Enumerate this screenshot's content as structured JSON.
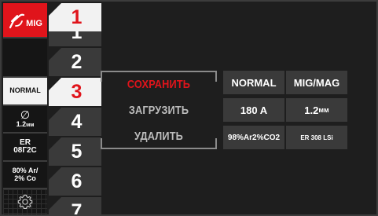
{
  "sidebar": {
    "process": "MIG",
    "mode": "NORMAL",
    "wire_diameter_symbol": "∅",
    "wire_diameter": "1.2",
    "wire_diameter_unit": "мм",
    "wire_type_line1": "ER",
    "wire_type_line2": "08Г2С",
    "gas_line1": "80% Ar/",
    "gas_line2": "2% Co"
  },
  "slots": [
    {
      "label": "1",
      "active": false
    },
    {
      "label": "2",
      "active": false
    },
    {
      "label": "3",
      "active": true
    },
    {
      "label": "4",
      "active": false
    },
    {
      "label": "5",
      "active": false
    },
    {
      "label": "6",
      "active": false
    },
    {
      "label": "7",
      "active": false
    }
  ],
  "menu": {
    "save": "СОХРАНИТЬ",
    "load": "ЗАГРУЗИТЬ",
    "delete": "УДАЛИТЬ"
  },
  "info": {
    "mode": "NORMAL",
    "process": "MIG/MAG",
    "current": "180 A",
    "wire_value": "1.2",
    "wire_unit": "мм",
    "gas": "98%Ar2%CO2",
    "wire_type": "ER 308 LSi"
  },
  "colors": {
    "accent": "#e0141b",
    "panel": "#3a3a3a",
    "background": "#1e1e1e",
    "active_tab": "#f2f2f2",
    "menu_text": "#bdbdbd"
  },
  "icons": {
    "process": "mig-torch-icon",
    "settings": "gear-icon"
  }
}
